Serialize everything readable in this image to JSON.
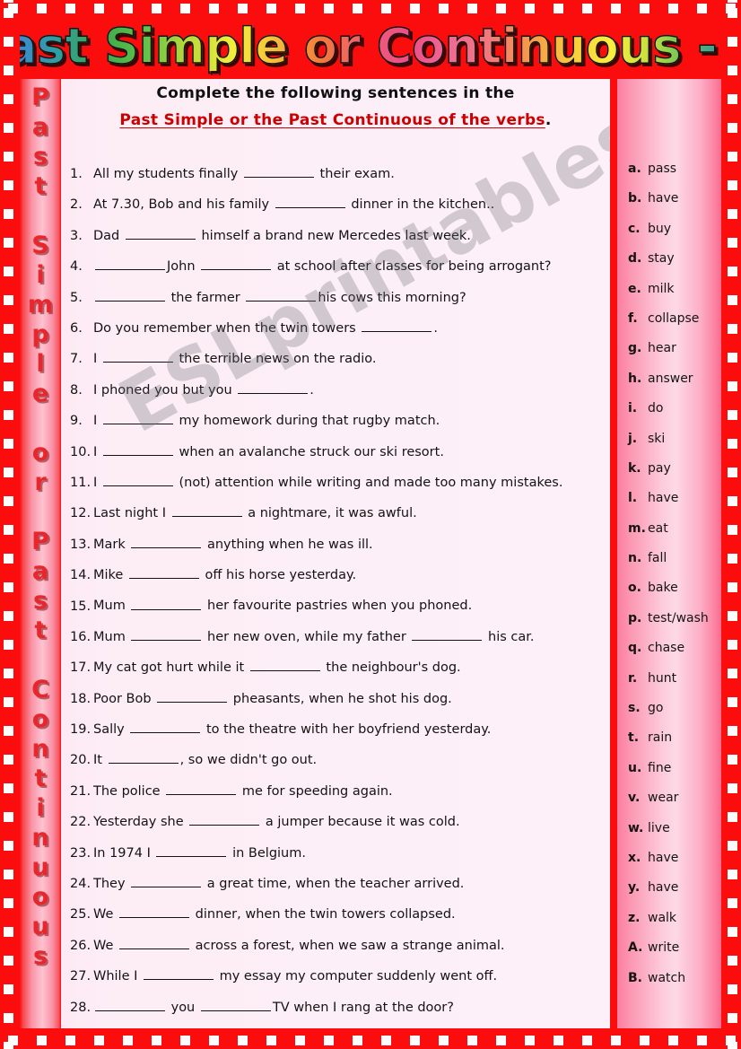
{
  "title": "Past Simple or Continuous - A",
  "watermark": "ESLprintables.com",
  "left_strip": {
    "vertical_text": "Past Simple or Past Continuous",
    "letters": [
      "P",
      "a",
      "s",
      "t",
      " ",
      "S",
      "i",
      "m",
      "p",
      "l",
      "e",
      " ",
      "o",
      "r",
      " ",
      "P",
      "a",
      "s",
      "t",
      " ",
      "C",
      "o",
      "n",
      "t",
      "i",
      "n",
      "u",
      "o",
      "u",
      "s"
    ]
  },
  "instruction": {
    "line1": "Complete the following sentences in the",
    "line2": "Past Simple or the Past Continuous of the verbs",
    "line2_suffix": "."
  },
  "sentences": [
    {
      "num": "1.",
      "parts": [
        "All my students finally ",
        "BLANK",
        " their exam."
      ]
    },
    {
      "num": "2.",
      "parts": [
        "At 7.30, Bob and his family ",
        "BLANK",
        " dinner in the kitchen.."
      ]
    },
    {
      "num": "3.",
      "parts": [
        "Dad ",
        "BLANK",
        " himself a brand new Mercedes last week."
      ]
    },
    {
      "num": "4.",
      "parts": [
        "",
        "BLANK",
        "John ",
        "BLANK",
        " at school after classes for being arrogant?"
      ]
    },
    {
      "num": "5.",
      "parts": [
        "",
        "BLANK",
        " the farmer ",
        "BLANK",
        "his cows this morning?"
      ]
    },
    {
      "num": "6.",
      "parts": [
        "Do you remember when the twin towers ",
        "BLANK",
        "."
      ]
    },
    {
      "num": "7.",
      "parts": [
        "I ",
        "BLANK",
        " the terrible news on the radio."
      ]
    },
    {
      "num": "8.",
      "parts": [
        "I phoned you but you ",
        "BLANK",
        "."
      ]
    },
    {
      "num": "9.",
      "parts": [
        "I ",
        "BLANK",
        " my homework during that rugby match."
      ]
    },
    {
      "num": "10.",
      "parts": [
        "I ",
        "BLANK",
        " when an avalanche struck our ski resort."
      ]
    },
    {
      "num": "11.",
      "parts": [
        "I ",
        "BLANK",
        " (not) attention while writing and made too many mistakes."
      ]
    },
    {
      "num": "12.",
      "parts": [
        "Last night I ",
        "BLANK",
        " a nightmare, it was awful."
      ]
    },
    {
      "num": "13.",
      "parts": [
        "Mark ",
        "BLANK",
        " anything when he was ill."
      ]
    },
    {
      "num": "14.",
      "parts": [
        "Mike ",
        "BLANK",
        " off his horse yesterday."
      ]
    },
    {
      "num": "15.",
      "parts": [
        "Mum ",
        "BLANK",
        " her favourite pastries when you phoned."
      ]
    },
    {
      "num": "16.",
      "parts": [
        "Mum ",
        "BLANK",
        " her new oven, while my father ",
        "BLANK",
        " his car."
      ]
    },
    {
      "num": "17.",
      "parts": [
        "My cat got hurt while it ",
        "BLANK",
        " the neighbour's dog."
      ]
    },
    {
      "num": "18.",
      "parts": [
        "Poor Bob ",
        "BLANK",
        " pheasants, when he shot his dog."
      ]
    },
    {
      "num": "19.",
      "parts": [
        "Sally ",
        "BLANK",
        " to the theatre with her boyfriend yesterday."
      ]
    },
    {
      "num": "20.",
      "parts": [
        "It ",
        "BLANK",
        ", so we didn't go out."
      ]
    },
    {
      "num": "21.",
      "parts": [
        "The police ",
        "BLANK",
        " me for speeding again."
      ]
    },
    {
      "num": "22.",
      "parts": [
        "Yesterday she ",
        "BLANK",
        " a jumper because it was cold."
      ]
    },
    {
      "num": "23.",
      "parts": [
        "In 1974 I ",
        "BLANK",
        " in Belgium."
      ]
    },
    {
      "num": "24.",
      "parts": [
        "They ",
        "BLANK",
        " a great time, when the teacher arrived."
      ]
    },
    {
      "num": "25.",
      "parts": [
        "We ",
        "BLANK",
        " dinner, when the twin towers collapsed."
      ]
    },
    {
      "num": "26.",
      "parts": [
        "We ",
        "BLANK",
        " across a forest, when we saw a strange animal."
      ]
    },
    {
      "num": "27.",
      "parts": [
        "While I ",
        "BLANK",
        " my essay my computer suddenly went off."
      ]
    },
    {
      "num": "28.",
      "parts": [
        "",
        "BLANK",
        " you ",
        "BLANK",
        "TV when I rang at the door?"
      ]
    }
  ],
  "verbs": [
    {
      "key": "a.",
      "word": "pass"
    },
    {
      "key": "b.",
      "word": "have"
    },
    {
      "key": "c.",
      "word": "buy"
    },
    {
      "key": "d.",
      "word": "stay"
    },
    {
      "key": "e.",
      "word": "milk"
    },
    {
      "key": "f.",
      "word": "collapse"
    },
    {
      "key": "g.",
      "word": "hear"
    },
    {
      "key": "h.",
      "word": "answer"
    },
    {
      "key": "i.",
      "word": "do"
    },
    {
      "key": "j.",
      "word": "ski"
    },
    {
      "key": "k.",
      "word": "pay"
    },
    {
      "key": "l.",
      "word": "have"
    },
    {
      "key": "m.",
      "word": "eat"
    },
    {
      "key": "n.",
      "word": "fall"
    },
    {
      "key": "o.",
      "word": "bake"
    },
    {
      "key": "p.",
      "word": "test/wash"
    },
    {
      "key": "q.",
      "word": "chase"
    },
    {
      "key": "r.",
      "word": "hunt"
    },
    {
      "key": "s.",
      "word": "go"
    },
    {
      "key": "t.",
      "word": "rain"
    },
    {
      "key": "u.",
      "word": "fine"
    },
    {
      "key": "v.",
      "word": "wear"
    },
    {
      "key": "w.",
      "word": "live"
    },
    {
      "key": "x.",
      "word": "have"
    },
    {
      "key": "y.",
      "word": "have"
    },
    {
      "key": "z.",
      "word": "walk"
    },
    {
      "key": "A.",
      "word": "write"
    },
    {
      "key": "B.",
      "word": "watch"
    }
  ],
  "colors": {
    "border_red": "#fb0d0d",
    "instruction_red": "#cc0000",
    "panel_pink": "#fdeef6",
    "right_panel_pink": "#fdc9da",
    "sidebar_letter_red": "#e8262b"
  }
}
